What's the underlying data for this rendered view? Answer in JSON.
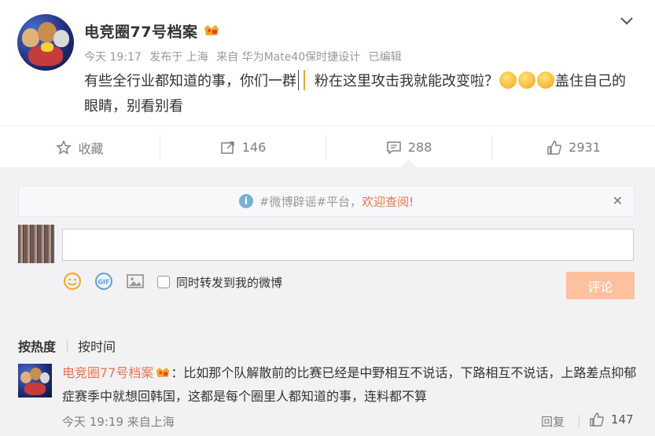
{
  "post": {
    "author": "电竞圈77号档案",
    "meta": {
      "time": "今天 19:17",
      "published_in": "发布于 上海",
      "source": "来自 华为Mate40保时捷设计",
      "edited": "已编辑"
    },
    "content_part1": "有些全行业都知道的事，你们一群",
    "content_part2": "粉在这里攻击我就能改变啦？",
    "content_part3": "盖住自己的眼睛，别看别看"
  },
  "actions": {
    "favorite_label": "收藏",
    "repost_count": "146",
    "comment_count": "288",
    "like_count": "2931"
  },
  "notice": {
    "prefix": "#微博辟谣#平台，",
    "highlight": "欢迎查阅!"
  },
  "composer": {
    "input_value": "",
    "repost_label": "同时转发到我的微博",
    "submit_label": "评论"
  },
  "sort": {
    "hot_label": "按热度",
    "time_label": "按时间"
  },
  "comments": [
    {
      "author": "电竞圈77号档案",
      "text": "：比如那个队解散前的比赛已经是中野相互不说话，下路相互不说话，上路差点抑郁症赛季中就想回韩国，这都是每个圈里人都知道的事，连料都不算",
      "time": "今天 19:19 来自上海",
      "reply_label": "回复",
      "likes": "147"
    }
  ],
  "colors": {
    "accent": "#eb7350",
    "submit_disabled": "#ffc09f",
    "muted": "#999999",
    "comment_bg": "#f2f2f5"
  }
}
